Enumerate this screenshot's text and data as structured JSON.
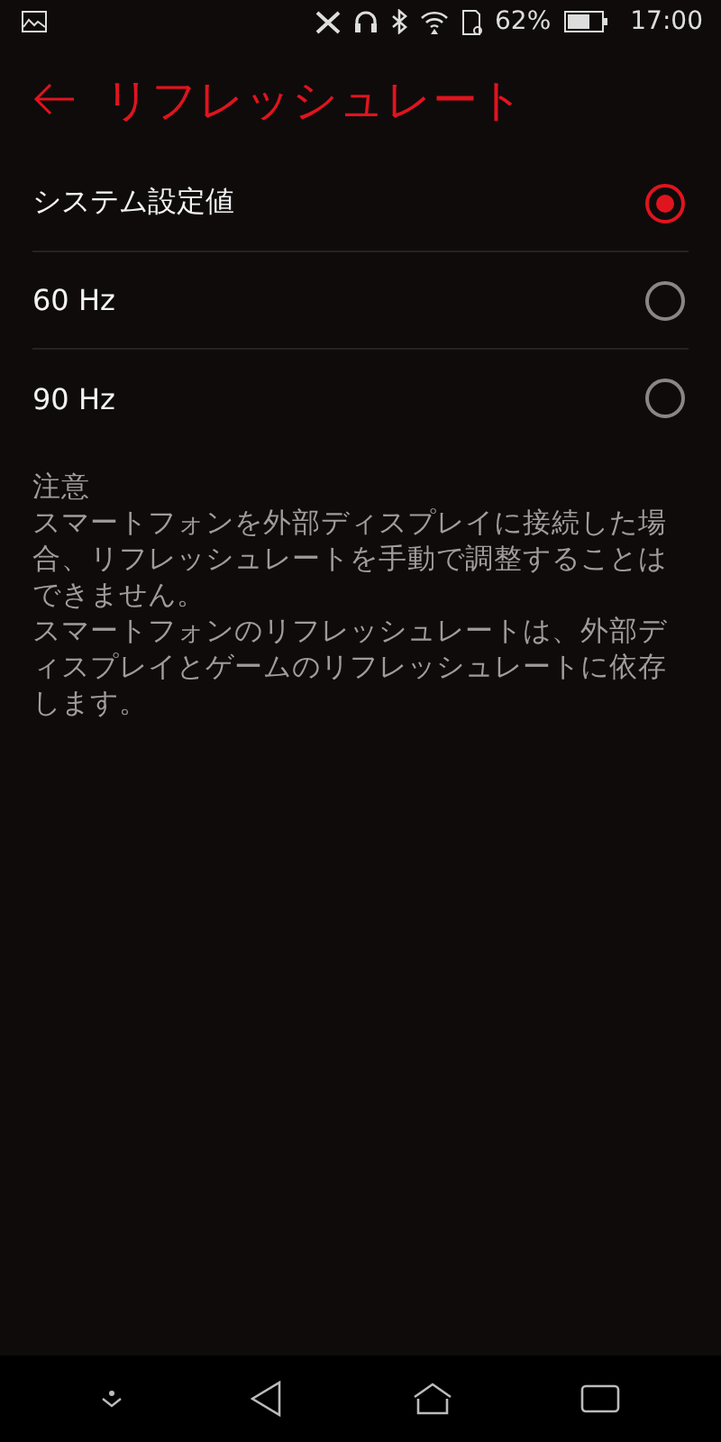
{
  "status_bar": {
    "battery": "62%",
    "time": "17:00"
  },
  "header": {
    "title": "リフレッシュレート"
  },
  "options": [
    {
      "label": "システム設定値",
      "selected": true
    },
    {
      "label": "60 Hz",
      "selected": false
    },
    {
      "label": "90 Hz",
      "selected": false
    }
  ],
  "note": {
    "heading": "注意",
    "paragraphs": [
      "スマートフォンを外部ディスプレイに接続した場合、リフレッシュレートを手動で調整することはできません。",
      "スマートフォンのリフレッシュレートは、外部ディスプレイとゲームのリフレッシュレートに依存します。"
    ]
  }
}
